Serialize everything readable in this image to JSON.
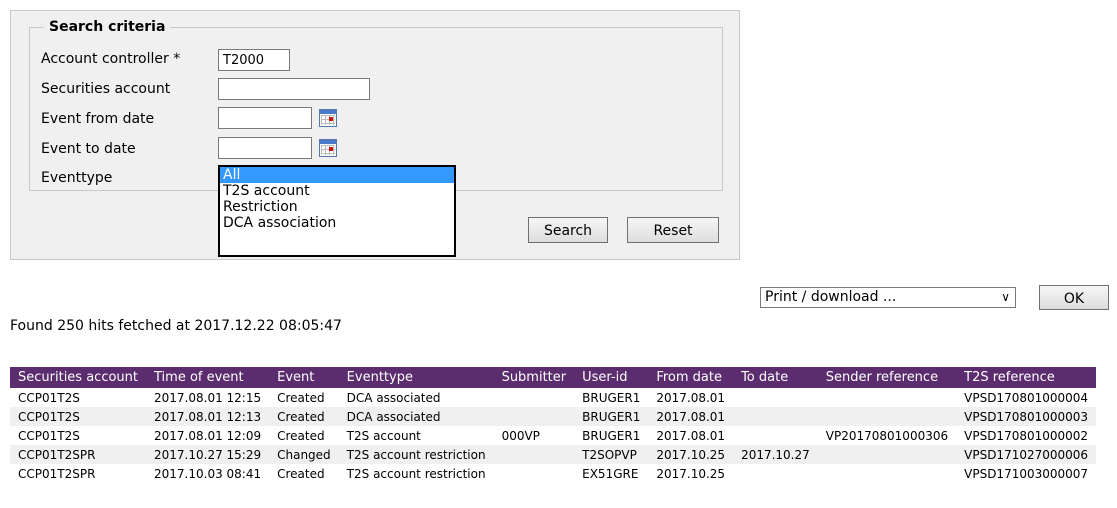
{
  "search": {
    "legend": "Search criteria",
    "fields": {
      "account_controller_label": "Account controller *",
      "account_controller_value": "T2000",
      "securities_account_label": "Securities account",
      "securities_account_value": "",
      "event_from_label": "Event from date",
      "event_from_value": "",
      "event_to_label": "Event to date",
      "event_to_value": "",
      "eventtype_label": "Eventtype"
    },
    "eventtype_options": [
      "All",
      "T2S account",
      "Restriction",
      "DCA association"
    ],
    "eventtype_selected": "All",
    "search_button": "Search",
    "reset_button": "Reset"
  },
  "print": {
    "select_value": "Print / download ...",
    "ok_button": "OK"
  },
  "results": {
    "found_text": "Found 250 hits fetched at 2017.12.22 08:05:47",
    "columns": [
      "Securities account",
      "Time of event",
      "Event",
      "Eventtype",
      "Submitter",
      "User-id",
      "From date",
      "To date",
      "Sender reference",
      "T2S reference"
    ],
    "rows": [
      [
        "CCP01T2S",
        "2017.08.01 12:15",
        "Created",
        "DCA associated",
        "",
        "BRUGER1",
        "2017.08.01",
        "",
        "",
        "VPSD170801000004"
      ],
      [
        "CCP01T2S",
        "2017.08.01 12:13",
        "Created",
        "DCA associated",
        "",
        "BRUGER1",
        "2017.08.01",
        "",
        "",
        "VPSD170801000003"
      ],
      [
        "CCP01T2S",
        "2017.08.01 12:09",
        "Created",
        "T2S account",
        "000VP",
        "BRUGER1",
        "2017.08.01",
        "",
        "VP20170801000306",
        "VPSD170801000002"
      ],
      [
        "CCP01T2SPR",
        "2017.10.27 15:29",
        "Changed",
        "T2S account restriction",
        "",
        "T2SOPVP",
        "2017.10.25",
        "2017.10.27",
        "",
        "VPSD171027000006"
      ],
      [
        "CCP01T2SPR",
        "2017.10.03 08:41",
        "Created",
        "T2S account restriction",
        "",
        "EX51GRE",
        "2017.10.25",
        "",
        "",
        "VPSD171003000007"
      ]
    ]
  },
  "icons": {
    "calendar": "calendar-icon",
    "dropdown_arrow": "chevron-down-icon"
  }
}
